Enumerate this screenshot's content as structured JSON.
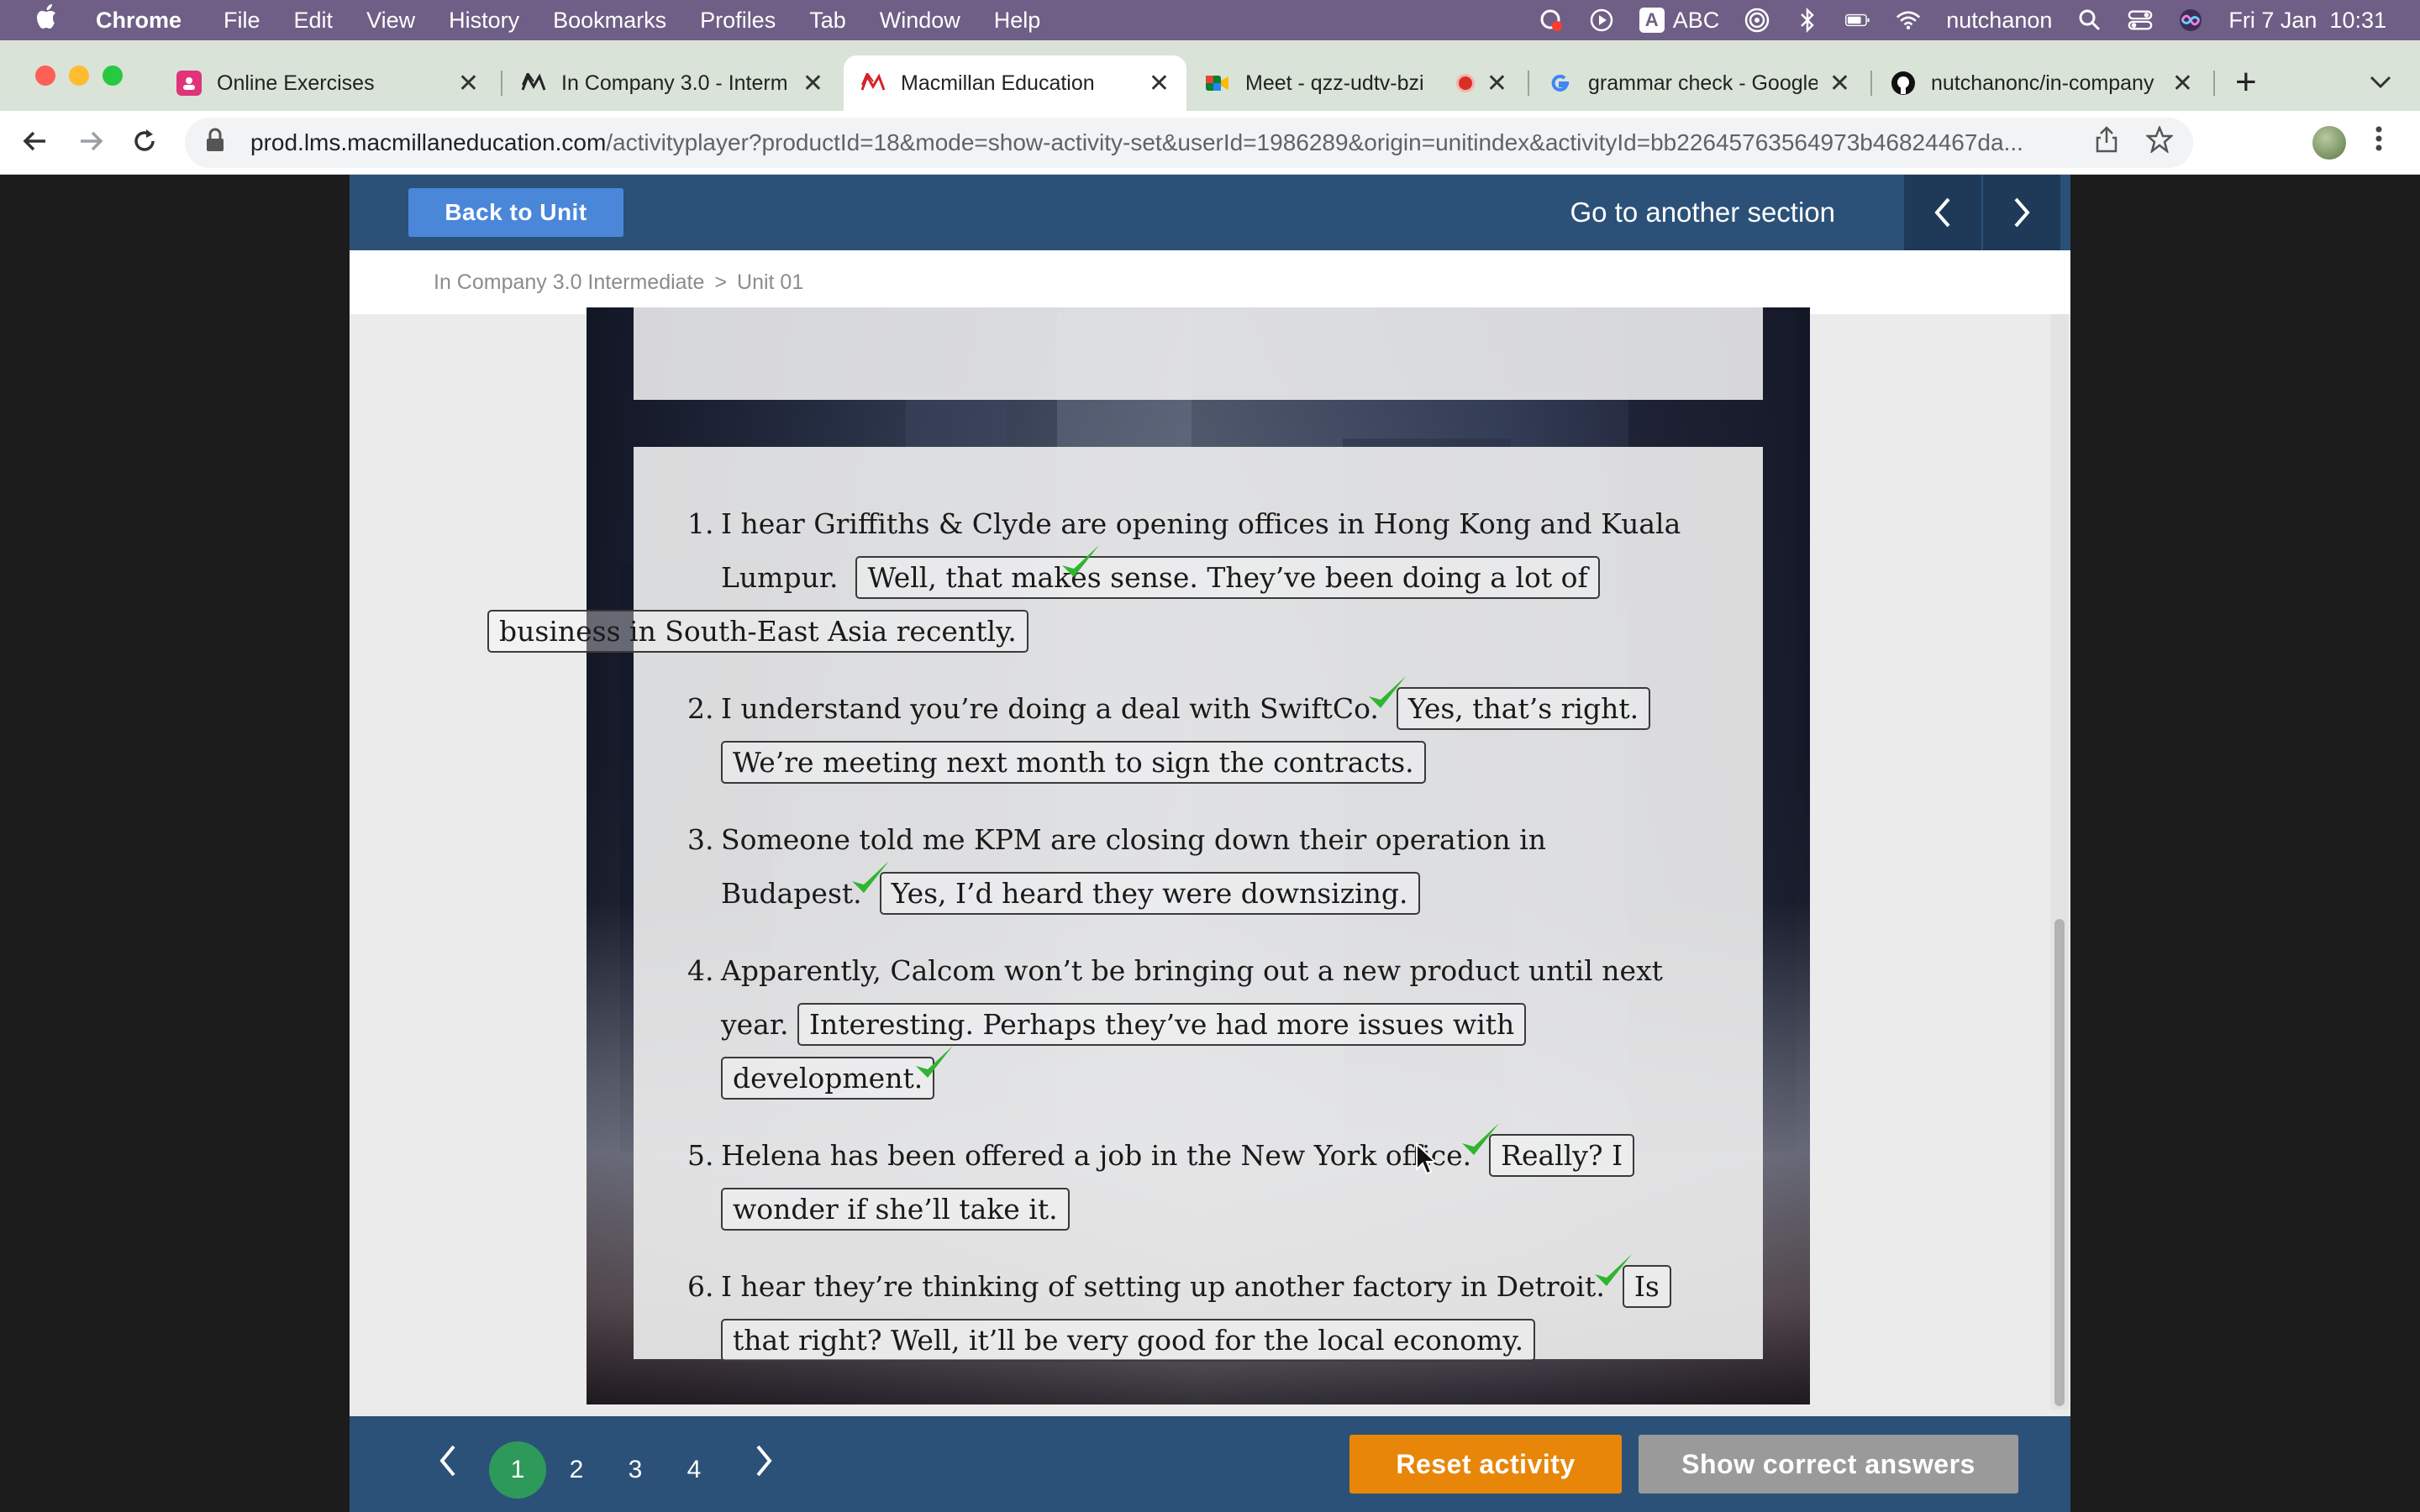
{
  "menubar": {
    "app_name": "Chrome",
    "items": [
      "File",
      "Edit",
      "View",
      "History",
      "Bookmarks",
      "Profiles",
      "Tab",
      "Window",
      "Help"
    ],
    "input_source": "ABC",
    "user": "nutchanon",
    "datetime": "Fri 7 Jan  10:31"
  },
  "tabs": [
    {
      "title": "Online Exercises",
      "icon": "online-exercises-icon",
      "active": false
    },
    {
      "title": "In Company 3.0 - Interm",
      "icon": "macmillan-icon",
      "active": false
    },
    {
      "title": "Macmillan Education",
      "icon": "macmillan-icon",
      "active": true
    },
    {
      "title": "Meet - qzz-udtv-bzi",
      "icon": "meet-icon",
      "active": false
    },
    {
      "title": "grammar check - Google",
      "icon": "google-icon",
      "active": false
    },
    {
      "title": "nutchanonc/in-company",
      "icon": "github-icon",
      "active": false
    }
  ],
  "address": {
    "host": "prod.lms.macmillaneducation.com",
    "path": "/activityplayer?productId=18&mode=show-activity-set&userId=1986289&origin=unitindex&activityId=bb22645763564973b46824467da..."
  },
  "page": {
    "back_to_unit": "Back to Unit",
    "goto_section": "Go to another section",
    "breadcrumb": {
      "course": "In Company 3.0 Intermediate",
      "separator": ">",
      "unit": "Unit 01"
    }
  },
  "exercise": {
    "items": [
      {
        "number": "1.",
        "prompt": "I hear Griffiths & Clyde are opening offices in Hong Kong and Kuala Lumpur.",
        "answer": "Well, that makes sense. They’ve been doing a lot of business in South-East Asia recently.",
        "correct": true
      },
      {
        "number": "2.",
        "prompt": "I understand you’re doing a deal with SwiftCo.",
        "answer": "Yes, that’s right. We’re meeting next month to sign the contracts.",
        "correct": true
      },
      {
        "number": "3.",
        "prompt": "Someone told me KPM are closing down their operation in Budapest.",
        "answer": "Yes, I’d heard they were downsizing.",
        "correct": true
      },
      {
        "number": "4.",
        "prompt": "Apparently, Calcom won’t be bringing out a new product until next year.",
        "answer": "Interesting. Perhaps they’ve had more issues with development.",
        "correct": true
      },
      {
        "number": "5.",
        "prompt": "Helena has been offered a job in the New York office.",
        "answer": "Really? I wonder if she’ll take it.",
        "correct": true
      },
      {
        "number": "6.",
        "prompt": "I hear they’re thinking of setting up another factory in Detroit.",
        "answer": "Is that right? Well, it’ll be very good for the local economy.",
        "correct": true
      }
    ]
  },
  "pagination": {
    "pages": [
      "1",
      "2",
      "3",
      "4"
    ],
    "current": "1"
  },
  "buttons": {
    "reset": "Reset activity",
    "show_answers": "Show correct answers"
  },
  "colors": {
    "menubar": "#6f5f86",
    "tabstrip": "#d9e3d8",
    "nav_blue": "#2c5179",
    "back_button": "#4a87d9",
    "page_current": "#2e9a5a",
    "reset_orange": "#e8860a",
    "show_gray": "#9a9a9a",
    "check_green": "#2fb52f"
  }
}
